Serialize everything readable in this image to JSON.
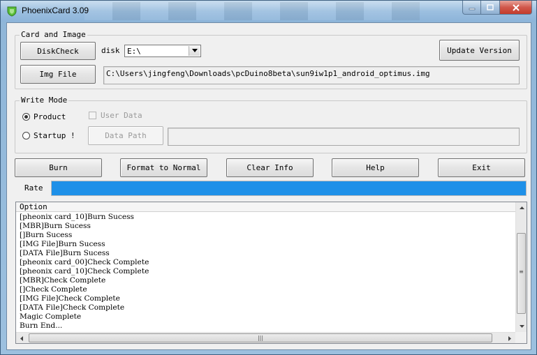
{
  "window": {
    "title": "PhoenixCard 3.09",
    "controls": {
      "minimize": "minimize-icon",
      "maximize": "maximize-icon",
      "close": "close-icon"
    }
  },
  "card_and_image": {
    "legend": "Card and Image",
    "diskcheck_label": "DiskCheck",
    "disk_label": "disk",
    "disk_value": "E:\\",
    "update_version_label": "Update Version",
    "img_file_label": "Img File",
    "img_path": "C:\\Users\\jingfeng\\Downloads\\pcDuino8beta\\sun9iw1p1_android_optimus.img"
  },
  "write_mode": {
    "legend": "Write Mode",
    "product_label": "Product",
    "product_selected": true,
    "startup_label": "Startup !",
    "startup_selected": false,
    "user_data_label": "User Data",
    "data_path_label": "Data Path",
    "data_path_value": ""
  },
  "actions": {
    "burn": "Burn",
    "format": "Format to Normal",
    "clear": "Clear Info",
    "help": "Help",
    "exit": "Exit"
  },
  "rate": {
    "label": "Rate",
    "progress_percent": 100,
    "color": "#1e90e8"
  },
  "log": {
    "header": "Option",
    "lines": [
      "[pheonix card_10]Burn Sucess",
      "[MBR]Burn Sucess",
      "[]Burn Sucess",
      "[IMG File]Burn Sucess",
      "[DATA File]Burn Sucess",
      "[pheonix card_00]Check Complete",
      "[pheonix card_10]Check Complete",
      "[MBR]Check Complete",
      "[]Check Complete",
      "[IMG File]Check Complete",
      "[DATA File]Check Complete",
      "Magic Complete",
      "Burn End..."
    ]
  }
}
